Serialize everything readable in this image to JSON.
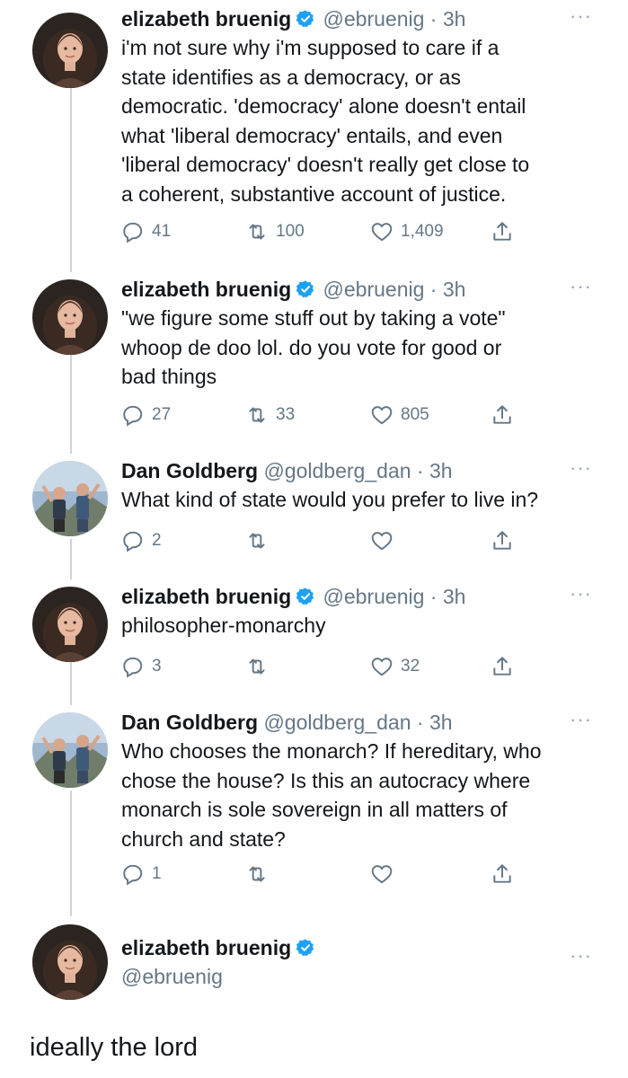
{
  "tweets": [
    {
      "name": "elizabeth bruenig",
      "verified": true,
      "handle": "@ebruenig",
      "dot": "·",
      "time": "3h",
      "text": "i'm not sure why i'm supposed to care if a\nstate identifies as a democracy, or as\ndemocratic. 'democracy' alone doesn't entail\nwhat 'liberal democracy' entails, and even\n'liberal democracy' doesn't really get close to\na coherent, substantive account of justice.",
      "replies": "41",
      "retweets": "100",
      "likes": "1,409",
      "avatar": "woman"
    },
    {
      "name": "elizabeth bruenig",
      "verified": true,
      "handle": "@ebruenig",
      "dot": "·",
      "time": "3h",
      "text": "\"we figure some stuff out by taking a vote\"\nwhoop de doo lol. do you vote for good or\nbad things",
      "replies": "27",
      "retweets": "33",
      "likes": "805",
      "avatar": "woman"
    },
    {
      "name": "Dan Goldberg",
      "verified": false,
      "handle": "@goldberg_dan",
      "dot": "·",
      "time": "3h",
      "text": "What kind of state would you prefer to live in?",
      "replies": "2",
      "retweets": "",
      "likes": "",
      "avatar": "outdoor"
    },
    {
      "name": "elizabeth bruenig",
      "verified": true,
      "handle": "@ebruenig",
      "dot": "·",
      "time": "3h",
      "text": "philosopher-monarchy",
      "replies": "3",
      "retweets": "",
      "likes": "32",
      "avatar": "woman"
    },
    {
      "name": "Dan Goldberg",
      "verified": false,
      "handle": "@goldberg_dan",
      "dot": "·",
      "time": "3h",
      "text": "Who chooses the monarch? If hereditary, who\nchose the house? Is this an autocracy where\nmonarch is sole sovereign in all matters of\nchurch and state?",
      "replies": "1",
      "retweets": "",
      "likes": "",
      "avatar": "outdoor"
    }
  ],
  "final": {
    "name": "elizabeth bruenig",
    "verified": true,
    "handle": "@ebruenig",
    "text": "ideally the lord",
    "avatar": "woman"
  },
  "more_glyph": "···",
  "colors": {
    "verified": "#1da1f2",
    "muted": "#657786",
    "thread_line": "#cfd4d9"
  }
}
